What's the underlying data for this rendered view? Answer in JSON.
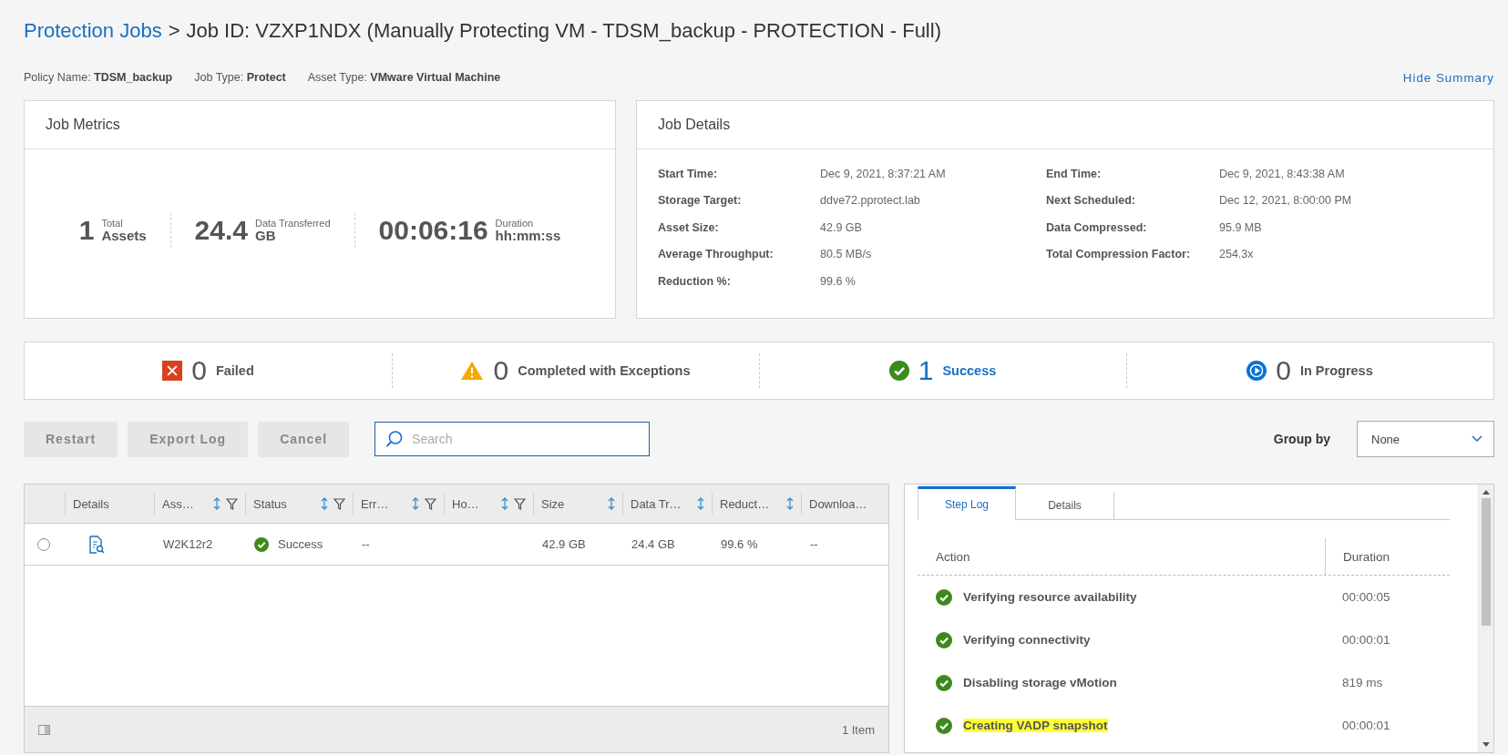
{
  "breadcrumb": {
    "link": "Protection Jobs",
    "separator": ">",
    "title": "Job ID: VZXP1NDX (Manually Protecting VM - TDSM_backup - PROTECTION - Full)"
  },
  "summary": {
    "fields": [
      {
        "label": "Policy Name:",
        "value": "TDSM_backup"
      },
      {
        "label": "Job Type:",
        "value": "Protect"
      },
      {
        "label": "Asset Type:",
        "value": "VMware Virtual Machine"
      }
    ],
    "toggle": "Hide Summary"
  },
  "job_metrics": {
    "title": "Job Metrics",
    "metrics": [
      {
        "value": "1",
        "caption": "Total",
        "unit": "Assets"
      },
      {
        "value": "24.4",
        "caption": "Data Transferred",
        "unit": "GB"
      },
      {
        "value": "00:06:16",
        "caption": "Duration",
        "unit": "hh:mm:ss"
      }
    ]
  },
  "job_details": {
    "title": "Job Details",
    "columns": [
      [
        {
          "label": "Start Time:",
          "value": "Dec 9, 2021, 8:37:21 AM"
        },
        {
          "label": "Storage Target:",
          "value": "ddve72.pprotect.lab"
        },
        {
          "label": "Asset Size:",
          "value": "42.9 GB"
        },
        {
          "label": "Average Throughput:",
          "value": "80.5 MB/s"
        },
        {
          "label": "Reduction %:",
          "value": "99.6 %"
        }
      ],
      [
        {
          "label": "End Time:",
          "value": "Dec 9, 2021, 8:43:38 AM"
        },
        {
          "label": "Next Scheduled:",
          "value": "Dec 12, 2021, 8:00:00 PM"
        },
        {
          "label": "Data Compressed:",
          "value": "95.9 MB"
        },
        {
          "label": "Total Compression Factor:",
          "value": "254.3x"
        }
      ]
    ]
  },
  "status_counts": [
    {
      "kind": "failed",
      "count": "0",
      "label": "Failed"
    },
    {
      "kind": "warning",
      "count": "0",
      "label": "Completed with Exceptions"
    },
    {
      "kind": "success",
      "count": "1",
      "label": "Success"
    },
    {
      "kind": "in_progress",
      "count": "0",
      "label": "In Progress"
    }
  ],
  "toolbar": {
    "buttons": [
      {
        "label": "Restart",
        "disabled": true
      },
      {
        "label": "Export Log",
        "disabled": true
      },
      {
        "label": "Cancel",
        "disabled": true
      }
    ],
    "search": {
      "placeholder": "Search"
    },
    "group_by": {
      "label": "Group by",
      "value": "None"
    }
  },
  "assets_table": {
    "columns": [
      {
        "label": "Details",
        "sortable": false,
        "filterable": false
      },
      {
        "label": "Ass…",
        "sortable": true,
        "filterable": true
      },
      {
        "label": "Status",
        "sortable": true,
        "filterable": true
      },
      {
        "label": "Err…",
        "sortable": true,
        "filterable": true
      },
      {
        "label": "Ho…",
        "sortable": true,
        "filterable": true
      },
      {
        "label": "Size",
        "sortable": true,
        "filterable": false
      },
      {
        "label": "Data Tr…",
        "sortable": true,
        "filterable": false
      },
      {
        "label": "Reduct…",
        "sortable": true,
        "filterable": false
      },
      {
        "label": "Downloa…",
        "sortable": false,
        "filterable": false
      }
    ],
    "rows": [
      {
        "selected": false,
        "asset": "W2K12r2",
        "status": {
          "kind": "success",
          "label": "Success"
        },
        "error": "--",
        "size": "42.9 GB",
        "data_transferred": "24.4 GB",
        "reduction": "99.6 %",
        "download": "--"
      }
    ],
    "footer": "1 Item"
  },
  "step_log": {
    "tabs": [
      {
        "label": "Step Log",
        "selected": true
      },
      {
        "label": "Details",
        "selected": false
      }
    ],
    "columns": [
      "Action",
      "Duration"
    ],
    "steps": [
      {
        "kind": "success",
        "action": "Verifying resource availability",
        "duration": "00:00:05",
        "highlighted": false
      },
      {
        "kind": "success",
        "action": "Verifying connectivity",
        "duration": "00:00:01",
        "highlighted": false
      },
      {
        "kind": "success",
        "action": "Disabling storage vMotion",
        "duration": "819 ms",
        "highlighted": false
      },
      {
        "kind": "success",
        "action": "Creating VADP snapshot",
        "duration": "00:00:01",
        "highlighted": true
      }
    ]
  }
}
